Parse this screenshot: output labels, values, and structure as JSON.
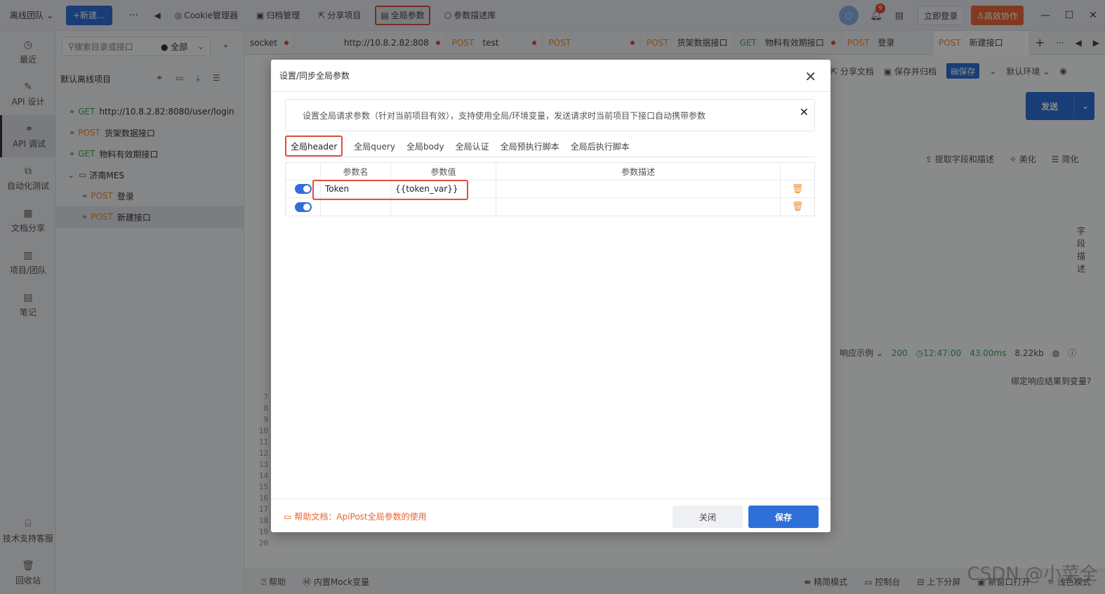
{
  "topbar": {
    "team": "离线团队",
    "new": "+新建...",
    "more": "···",
    "back": "◀",
    "tools": [
      {
        "icon": "cookie-icon",
        "label": "Cookie管理器"
      },
      {
        "icon": "archive-icon",
        "label": "归档管理"
      },
      {
        "icon": "share-icon",
        "label": "分享项目"
      },
      {
        "icon": "globe-param-icon",
        "label": "全局参数"
      },
      {
        "icon": "cube-icon",
        "label": "参数描述库"
      }
    ],
    "notif_count": "9",
    "login": "立即登录",
    "collab": "高效协作"
  },
  "rail": {
    "items": [
      {
        "label": "最近"
      },
      {
        "label": "API 设计"
      },
      {
        "label": "API 调试"
      },
      {
        "label": "自动化测试"
      },
      {
        "label": "文档分享"
      },
      {
        "label": "项目/团队"
      },
      {
        "label": "笔记"
      }
    ],
    "bottom": [
      {
        "label": "技术支持客服"
      },
      {
        "label": "回收站"
      }
    ]
  },
  "tree": {
    "search_placeholder": "搜索目录或接口",
    "filter": "全部",
    "project": "默认离线项目",
    "items": [
      {
        "method": "GET",
        "name": "http://10.8.2.82:8080/user/login"
      },
      {
        "method": "POST",
        "name": "货架数据接口"
      },
      {
        "method": "GET",
        "name": "物料有效期接口"
      },
      {
        "folder": "济南MES"
      },
      {
        "method": "POST",
        "name": "登录"
      },
      {
        "method": "POST",
        "name": "新建接口"
      }
    ]
  },
  "tabs": [
    {
      "method": "",
      "name": "socket"
    },
    {
      "method": "",
      "name": "http://10.8.2.82:808"
    },
    {
      "method": "POST",
      "name": "test"
    },
    {
      "method": "POST",
      "name": ""
    },
    {
      "method": "POST",
      "name": "货架数据接口"
    },
    {
      "method": "GET",
      "name": "物料有效期接口"
    },
    {
      "method": "POST",
      "name": "登录"
    },
    {
      "method": "POST",
      "name": "新建接口"
    }
  ],
  "workspace": {
    "share_doc": "分享文档",
    "save_archive": "保存并归档",
    "save": "保存",
    "env": "默认环境",
    "send": "发送",
    "tools": [
      "提取字段和描述",
      "美化",
      "简化"
    ],
    "side_vertical": "字段描述",
    "resp_example": "响应示例",
    "status": "200",
    "time": "12:47:00",
    "duration": "43.00ms",
    "size": "8.22kb",
    "bind": "绑定响应结果到变量?",
    "line_numbers": "7\n8\n9\n10\n11\n12\n13\n14\n15\n16\n17\n18\n19\n20",
    "bottom_left": [
      "帮助",
      "内置Mock变量"
    ],
    "bottom_right": [
      "精简模式",
      "控制台",
      "上下分屏",
      "新窗口打开",
      "浅色模式"
    ],
    "watermark": "CSDN @小菜全"
  },
  "modal": {
    "title": "设置/同步全局参数",
    "notice": "设置全局请求参数（针对当前项目有效），支持使用全局/环境变量，发送请求时当前项目下接口自动携带参数",
    "tabs": [
      "全局header",
      "全局query",
      "全局body",
      "全局认证",
      "全局预执行脚本",
      "全局后执行脚本"
    ],
    "columns": {
      "name": "参数名",
      "value": "参数值",
      "desc": "参数描述"
    },
    "rows": [
      {
        "name": "Token",
        "value": "{{token_var}}",
        "desc": ""
      },
      {
        "name": "",
        "value": "",
        "desc": ""
      }
    ],
    "help": "帮助文档：ApiPost全局参数的使用",
    "close": "关闭",
    "save": "保存"
  }
}
